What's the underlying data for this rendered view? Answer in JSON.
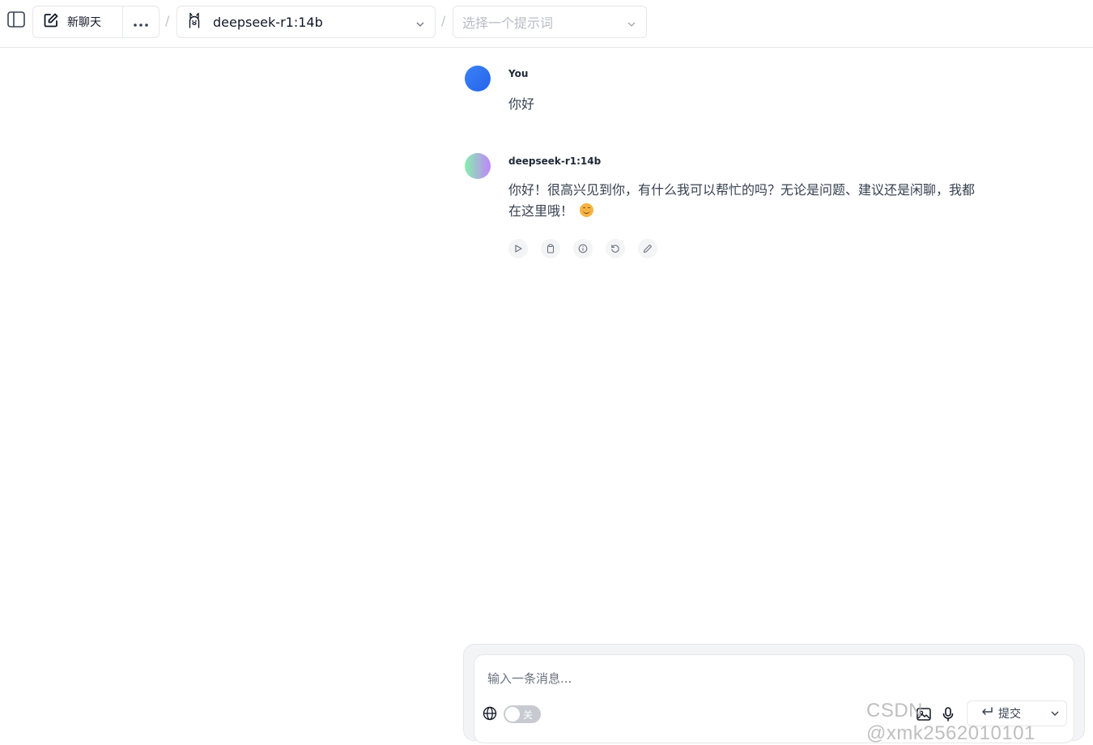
{
  "header": {
    "new_chat_label": "新聊天",
    "separator": "/",
    "model": {
      "name": "deepseek-r1:14b"
    },
    "prompt_select": {
      "placeholder": "选择一个提示词"
    }
  },
  "messages": [
    {
      "role": "user",
      "sender": "You",
      "text": "你好",
      "avatar_color": "#3b82f6"
    },
    {
      "role": "assistant",
      "sender": "deepseek-r1:14b",
      "text": "你好！很高兴见到你，有什么我可以帮忙的吗？无论是问题、建议还是闲聊，我都在这里哦！",
      "emoji": "smiling-face",
      "actions": [
        "play-icon",
        "copy-icon",
        "info-icon",
        "regenerate-icon",
        "edit-icon"
      ]
    }
  ],
  "composer": {
    "placeholder": "输入一条消息...",
    "web_search_toggle": {
      "label": "关",
      "state": "off"
    },
    "send_label": "提交"
  },
  "watermark": "CSDN @xmk2562010101"
}
